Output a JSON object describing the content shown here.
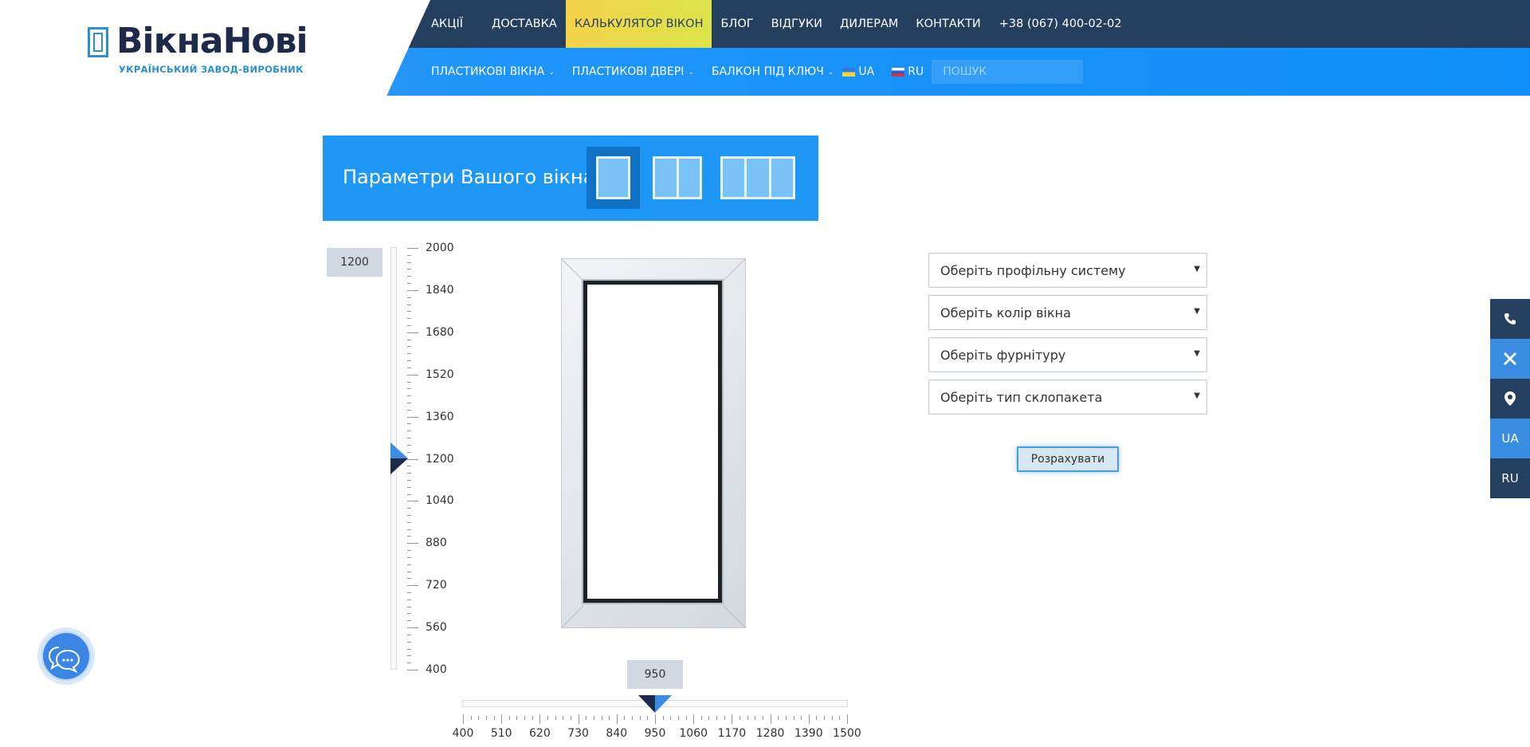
{
  "brand": {
    "name": "ВікнаНові",
    "tagline": "УКРАЇНСЬКИЙ ЗАВОД-ВИРОБНИК"
  },
  "top_nav": [
    {
      "label": "АКЦІЇ",
      "active": false
    },
    {
      "label": "ДОСТАВКА",
      "active": false
    },
    {
      "label": "КАЛЬКУЛЯТОР ВІКОН",
      "active": true
    },
    {
      "label": "БЛОГ",
      "active": false
    },
    {
      "label": "ВІДГУКИ",
      "active": false
    },
    {
      "label": "ДИЛЕРАМ",
      "active": false
    },
    {
      "label": "КОНТАКТИ",
      "active": false
    },
    {
      "label": "+38 (067) 400-02-02",
      "active": false
    }
  ],
  "sub_nav": {
    "items": [
      {
        "label": "ПЛАСТИКОВІ ВІКНА",
        "has_dropdown": true
      },
      {
        "label": "ПЛАСТИКОВІ ДВЕРІ",
        "has_dropdown": true
      },
      {
        "label": "БАЛКОН ПІД КЛЮЧ",
        "has_dropdown": true
      }
    ],
    "lang_ua": "UA",
    "lang_ru": "RU",
    "search_placeholder": "ПОШУК"
  },
  "calculator": {
    "title": "Параметри Вашого вікна",
    "window_types": [
      {
        "name": "single",
        "selected": true
      },
      {
        "name": "double",
        "selected": false
      },
      {
        "name": "triple",
        "selected": false
      }
    ],
    "height": {
      "value": "1200",
      "min": 400,
      "max": 2000,
      "labels": [
        "2000",
        "1840",
        "1680",
        "1520",
        "1360",
        "1200",
        "1040",
        "880",
        "720",
        "560",
        "400"
      ]
    },
    "width": {
      "value": "950",
      "min": 400,
      "max": 1500,
      "labels": [
        "400",
        "510",
        "620",
        "730",
        "840",
        "950",
        "1060",
        "1170",
        "1280",
        "1390",
        "1500"
      ]
    },
    "selects": [
      {
        "value": "Оберіть профільну систему"
      },
      {
        "value": "Оберіть колір вікна"
      },
      {
        "value": "Оберіть фурнітуру"
      },
      {
        "value": "Оберіть тип склопакета"
      }
    ],
    "calculate_label": "Розрахувати"
  },
  "side_toolbar": [
    {
      "icon": "phone-icon",
      "label": "",
      "style": "dark"
    },
    {
      "icon": "tools-icon",
      "label": "",
      "style": "blue"
    },
    {
      "icon": "map-marker-icon",
      "label": "",
      "style": "dark"
    },
    {
      "icon": "",
      "label": "UA",
      "style": "blue"
    },
    {
      "icon": "",
      "label": "RU",
      "style": "dark"
    }
  ],
  "colors": {
    "header_dark": "#25405e",
    "header_blue": "#1f95f8",
    "active_tab": "#f4d24a",
    "accent": "#1f97f6"
  }
}
